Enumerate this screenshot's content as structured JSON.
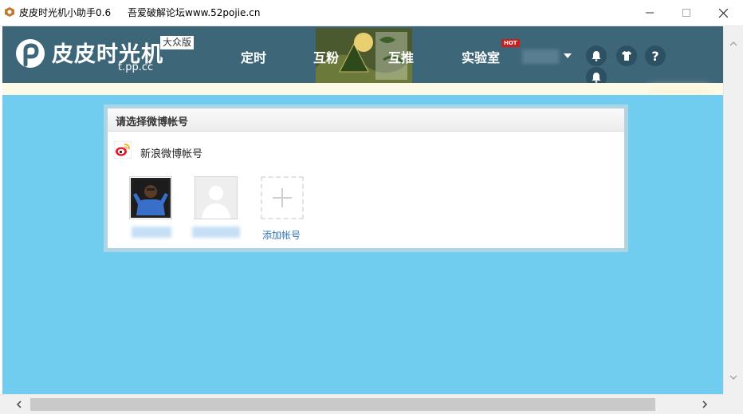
{
  "window": {
    "title": "皮皮时光机小助手0.6",
    "forum": "吾爱破解论坛www.52pojie.cn"
  },
  "header": {
    "logo_text": "皮皮时光机",
    "edition_badge": "大众版",
    "domain": "t.pp.cc",
    "nav": [
      "定时",
      "互粉",
      "互推",
      "实验室"
    ],
    "hot_badge": "HOT",
    "banner_icon": "dragon-boat-festival-banner"
  },
  "header_buttons": {
    "bell": "bell-icon",
    "shirt": "tshirt-icon",
    "help": "?",
    "bell2": "bell-icon"
  },
  "panel": {
    "title": "请选择微博帐号",
    "provider_label": "新浪微博帐号",
    "add_label": "添加帐号"
  },
  "colors": {
    "header": "#3d6679",
    "main_bg": "#71cdf0",
    "link": "#2e78b7"
  }
}
